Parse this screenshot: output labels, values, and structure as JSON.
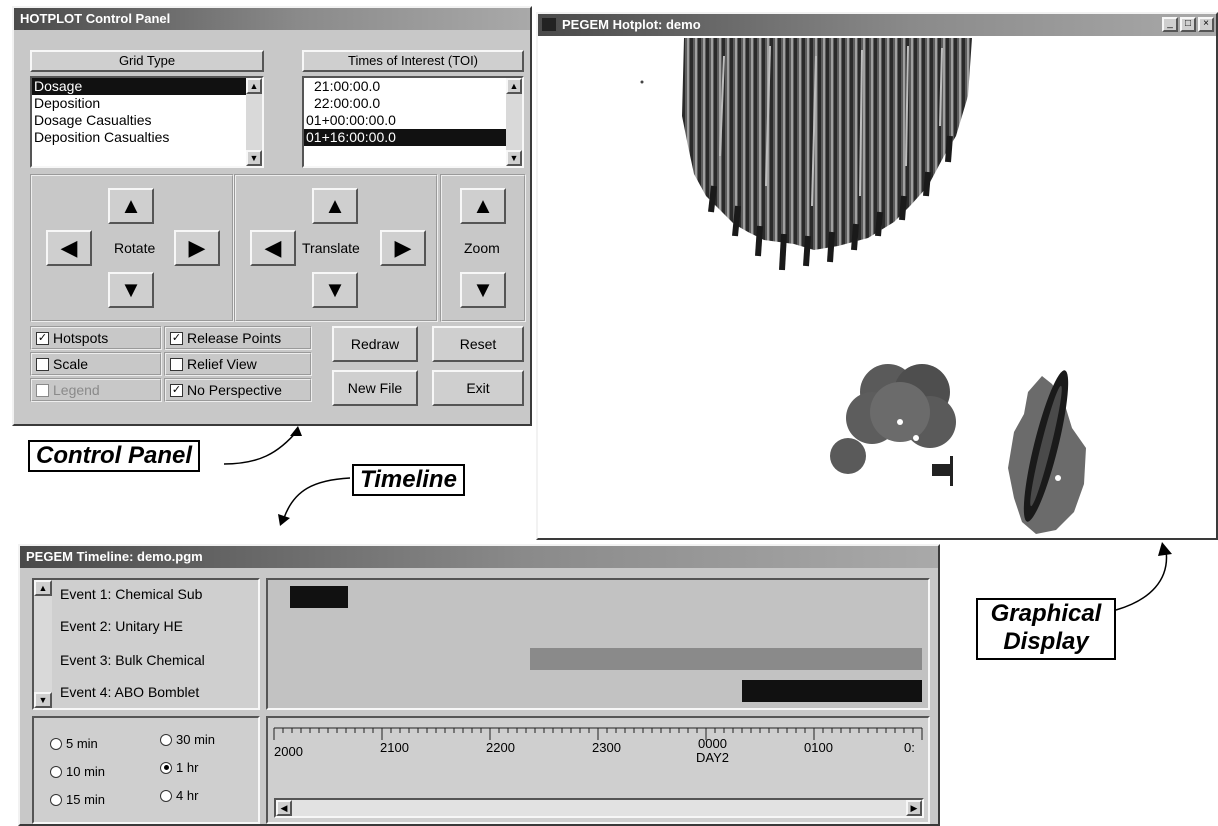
{
  "control_panel": {
    "title": "HOTPLOT Control Panel",
    "grid_type": {
      "header": "Grid Type",
      "items": [
        "Dosage",
        "Deposition",
        "Dosage Casualties",
        "Deposition Casualties"
      ],
      "selected": "Dosage"
    },
    "toi": {
      "header": "Times of Interest (TOI)",
      "items": [
        "21:00:00.0",
        "22:00:00.0",
        "01+00:00:00.0",
        "01+16:00:00.0"
      ],
      "selected": "01+16:00:00.0"
    },
    "rotate_label": "Rotate",
    "translate_label": "Translate",
    "zoom_label": "Zoom",
    "checkboxes": {
      "hotspots": "Hotspots",
      "scale": "Scale",
      "legend": "Legend",
      "release_points": "Release Points",
      "relief_view": "Relief View",
      "no_perspective": "No Perspective"
    },
    "buttons": {
      "redraw": "Redraw",
      "reset": "Reset",
      "new_file": "New File",
      "exit": "Exit"
    }
  },
  "display": {
    "title": "PEGEM Hotplot: demo"
  },
  "timeline": {
    "title": "PEGEM Timeline: demo.pgm",
    "events": [
      "Event 1: Chemical Sub",
      "Event 2: Unitary HE",
      "Event 3: Bulk Chemical",
      "Event 4: ABO Bomblet"
    ],
    "intervals": [
      "5 min",
      "10 min",
      "15 min",
      "30 min",
      "1 hr",
      "4 hr"
    ],
    "selected_interval": "1 hr",
    "ticks": [
      "2000",
      "2100",
      "2200",
      "2300",
      "0000",
      "0100",
      "0:"
    ],
    "day_label": "DAY2"
  },
  "callouts": {
    "control_panel": "Control Panel",
    "timeline": "Timeline",
    "graphical_display_line1": "Graphical",
    "graphical_display_line2": "Display"
  }
}
